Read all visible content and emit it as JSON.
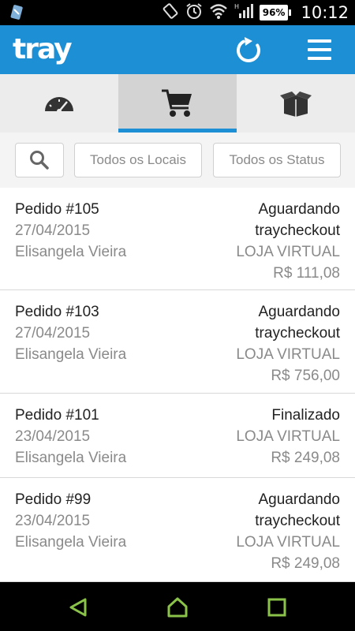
{
  "status": {
    "battery": "96%",
    "time": "10:12"
  },
  "app": {
    "logo": "tray"
  },
  "filters": {
    "locais": "Todos os Locais",
    "status": "Todos os Status"
  },
  "orders": [
    {
      "id": "Pedido #105",
      "date": "27/04/2015",
      "customer": "Elisangela Vieira",
      "status_line1": "Aguardando",
      "status_line2": "traycheckout",
      "store": "LOJA VIRTUAL",
      "total": "R$ 111,08"
    },
    {
      "id": "Pedido #103",
      "date": "27/04/2015",
      "customer": "Elisangela Vieira",
      "status_line1": "Aguardando",
      "status_line2": "traycheckout",
      "store": "LOJA VIRTUAL",
      "total": "R$ 756,00"
    },
    {
      "id": "Pedido #101",
      "date": "23/04/2015",
      "customer": "Elisangela Vieira",
      "status_line1": "Finalizado",
      "status_line2": "",
      "store": "LOJA VIRTUAL",
      "total": "R$ 249,08"
    },
    {
      "id": "Pedido #99",
      "date": "23/04/2015",
      "customer": "Elisangela Vieira",
      "status_line1": "Aguardando",
      "status_line2": "traycheckout",
      "store": "LOJA VIRTUAL",
      "total": "R$ 249,08"
    }
  ],
  "colors": {
    "primary": "#1d8fd4",
    "nav_icons": "#8bc34a",
    "text_dark": "#222222",
    "text_gray": "#8a8a8a"
  }
}
